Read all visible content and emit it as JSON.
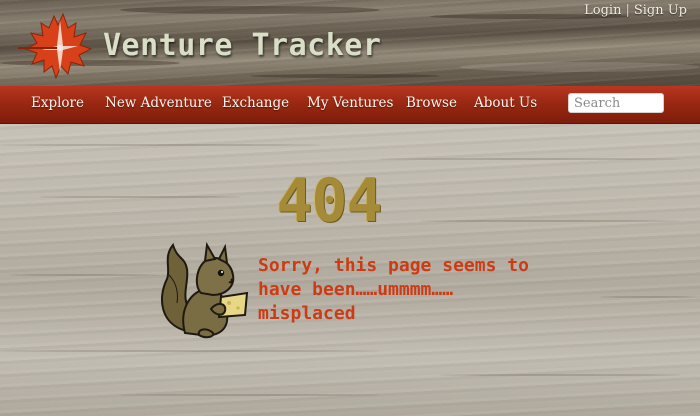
{
  "header": {
    "site_title": "Venture Tracker",
    "auth": {
      "login": "Login",
      "separator": "|",
      "signup": "Sign Up"
    }
  },
  "nav": {
    "items": [
      "Explore",
      "New Adventure",
      "Exchange",
      "My Ventures",
      "Browse",
      "About Us"
    ],
    "search_placeholder": "Search"
  },
  "error": {
    "code": "404",
    "message_lines": [
      "Sorry, this page seems to",
      "have been……ummmm……",
      "misplaced"
    ]
  },
  "colors": {
    "nav_bar": "#9b2812",
    "error_code": "#a58a37",
    "message": "#cc3b14",
    "title": "#d9dfc6",
    "logo_leaf": "#d8401a"
  },
  "icons": {
    "logo": "maple-leaf-compass-icon",
    "illustration": "squirrel-holding-cheese"
  }
}
